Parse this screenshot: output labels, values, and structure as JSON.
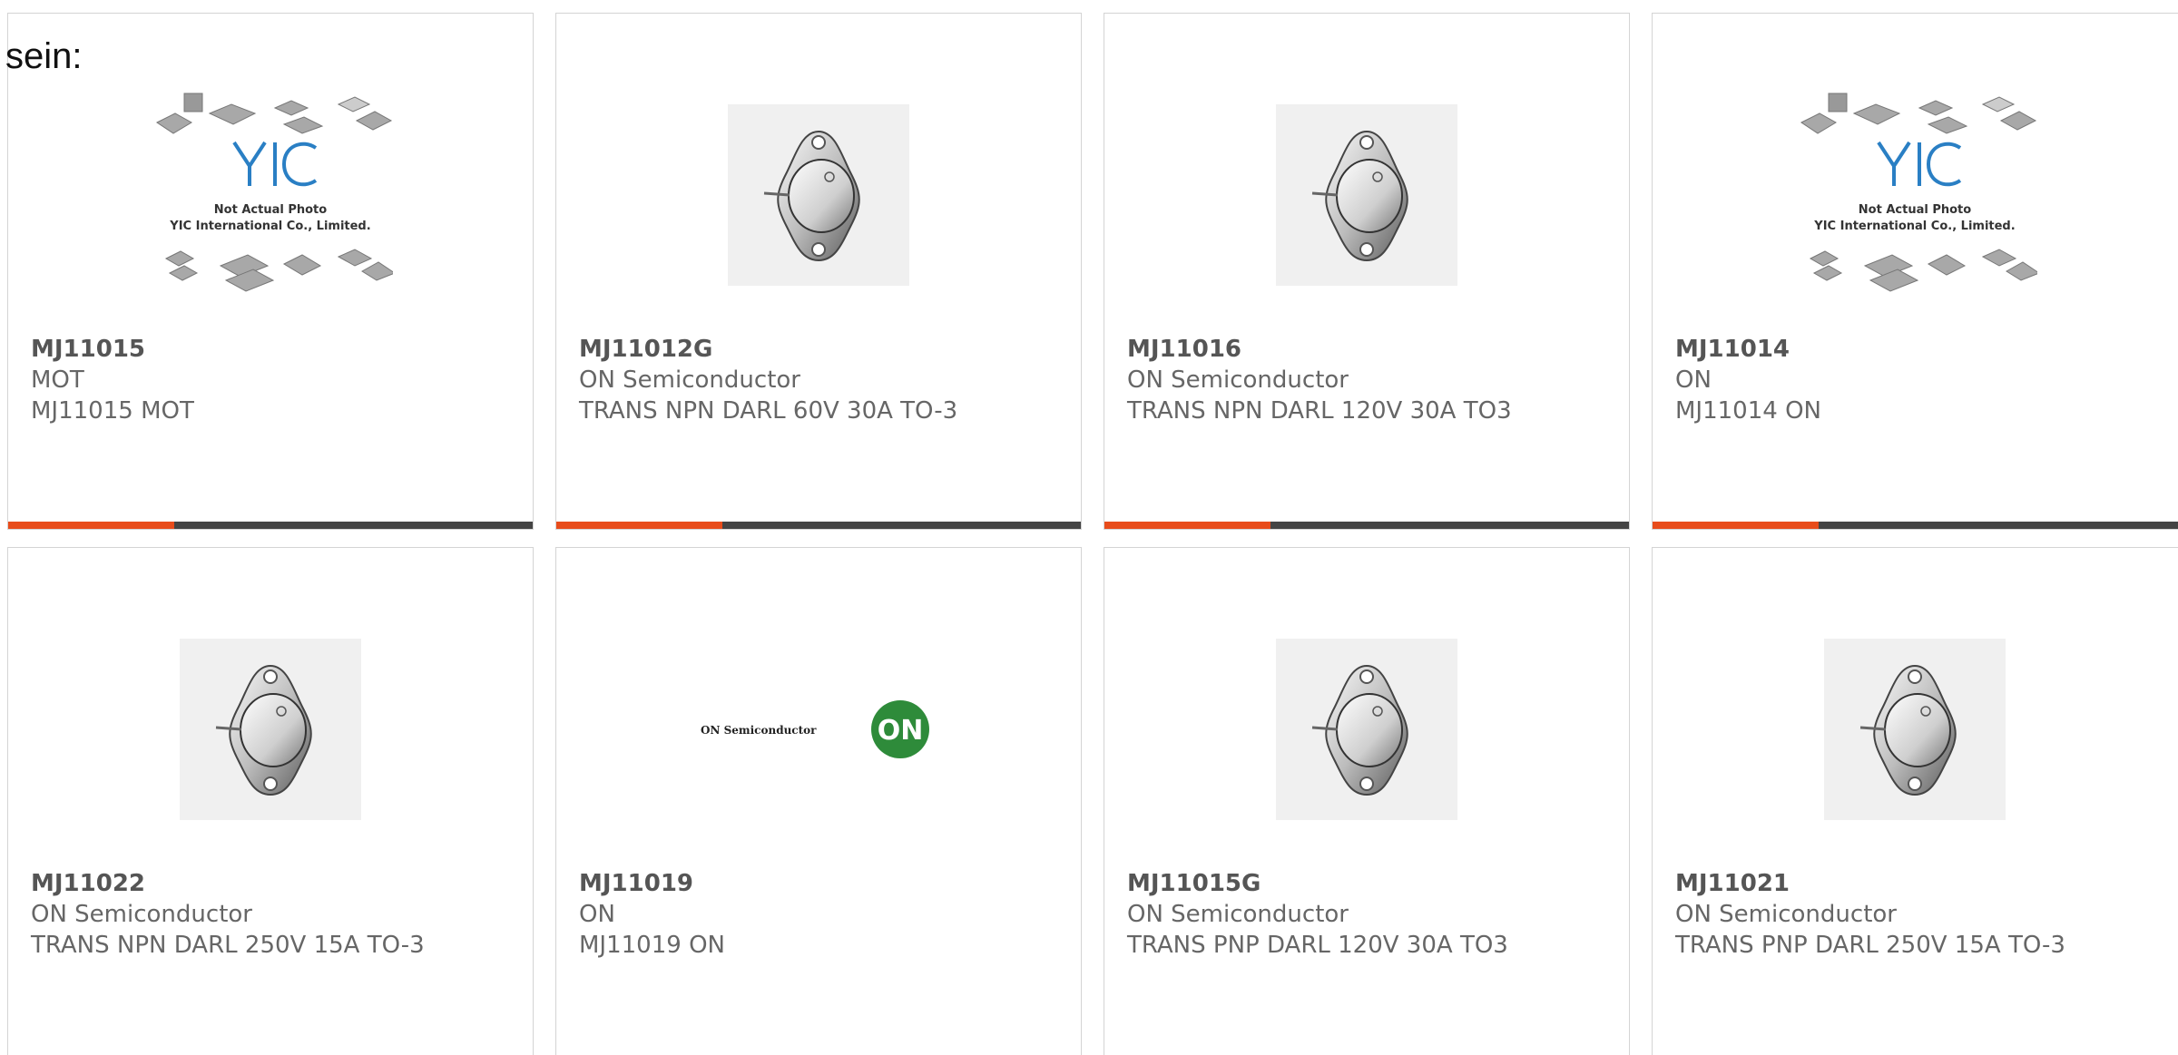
{
  "heading_fragment": "sein:",
  "products": [
    {
      "part": "MJ11015",
      "manufacturer": "MOT",
      "description": "MJ11015 MOT",
      "image": "placeholder",
      "has_accent_bar": true
    },
    {
      "part": "MJ11012G",
      "manufacturer": "ON Semiconductor",
      "description": "TRANS NPN DARL 60V 30A TO-3",
      "image": "to3",
      "has_accent_bar": true
    },
    {
      "part": "MJ11016",
      "manufacturer": "ON Semiconductor",
      "description": "TRANS NPN DARL 120V 30A TO3",
      "image": "to3",
      "has_accent_bar": true
    },
    {
      "part": "MJ11014",
      "manufacturer": "ON",
      "description": "MJ11014 ON",
      "image": "placeholder",
      "has_accent_bar": true
    },
    {
      "part": "MJ11022",
      "manufacturer": "ON Semiconductor",
      "description": "TRANS NPN DARL 250V 15A TO-3",
      "image": "to3",
      "has_accent_bar": false
    },
    {
      "part": "MJ11019",
      "manufacturer": "ON",
      "description": "MJ11019 ON",
      "image": "on-logo",
      "has_accent_bar": false
    },
    {
      "part": "MJ11015G",
      "manufacturer": "ON Semiconductor",
      "description": "TRANS PNP DARL 120V 30A TO3",
      "image": "to3",
      "has_accent_bar": false
    },
    {
      "part": "MJ11021",
      "manufacturer": "ON Semiconductor",
      "description": "TRANS PNP DARL 250V 15A TO-3",
      "image": "to3",
      "has_accent_bar": false
    }
  ],
  "placeholder_image": {
    "brand": "YIC",
    "line1": "Not Actual Photo",
    "line2": "YIC International Co., Limited."
  },
  "on_logo": {
    "wordmark": "ON Semiconductor",
    "badge": "ON"
  },
  "colors": {
    "accent": "#e84c1b",
    "bar": "#444444",
    "border": "#d4d4d4",
    "text": "#666666",
    "on_green": "#2e8b3a"
  }
}
